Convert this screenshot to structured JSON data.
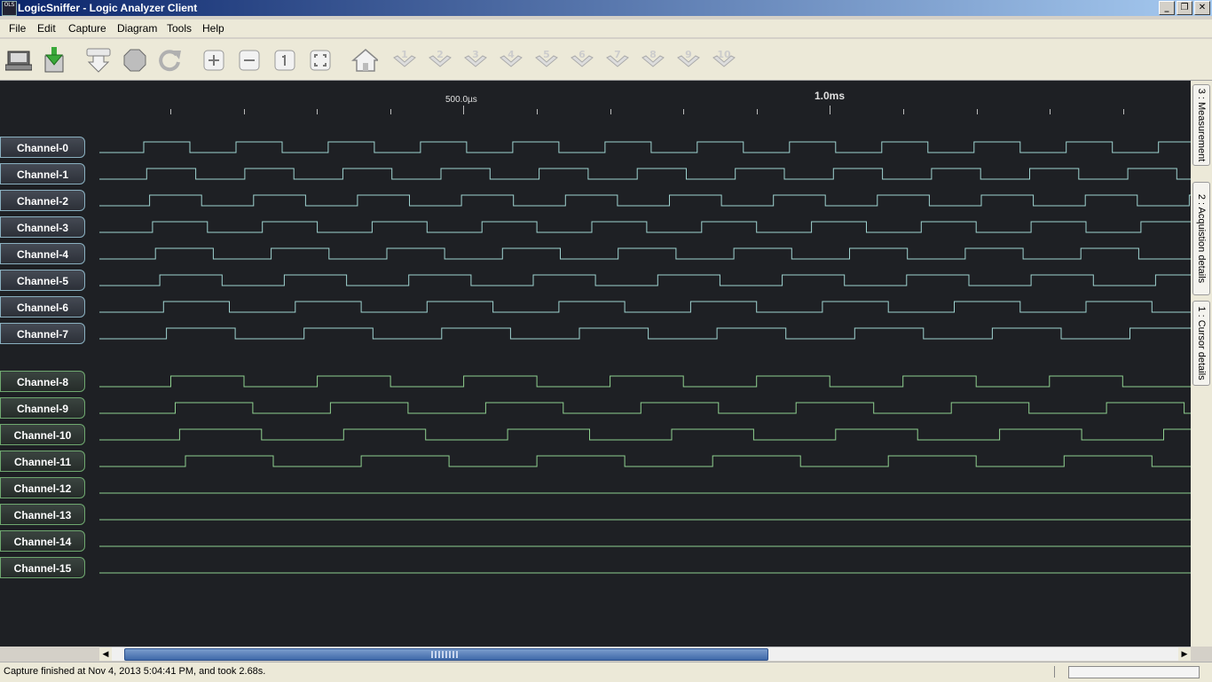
{
  "window": {
    "logo_text": "OLS",
    "title": "LogicSniffer - Logic Analyzer Client",
    "minimize": "_",
    "restore": "❐",
    "close": "✕"
  },
  "menu": [
    {
      "label": "File"
    },
    {
      "label": "Edit"
    },
    {
      "label": "Capture"
    },
    {
      "label": "Diagram"
    },
    {
      "label": "Tools"
    },
    {
      "label": "Help"
    }
  ],
  "toolbar": {
    "cursor_numbers": [
      "1",
      "2",
      "3",
      "4",
      "5",
      "6",
      "7",
      "8",
      "9",
      "10"
    ]
  },
  "ruler": {
    "label_500": "500.0µs",
    "label_1ms": "1.0ms"
  },
  "channels": [
    {
      "name": "Channel-0",
      "color": "#9fd3d0",
      "half_period_us": 63
    },
    {
      "name": "Channel-1",
      "color": "#9fd3d0",
      "half_period_us": 67
    },
    {
      "name": "Channel-2",
      "color": "#9fd3d0",
      "half_period_us": 71
    },
    {
      "name": "Channel-3",
      "color": "#9fd3d0",
      "half_period_us": 75
    },
    {
      "name": "Channel-4",
      "color": "#9fd3d0",
      "half_period_us": 79
    },
    {
      "name": "Channel-5",
      "color": "#9fd3d0",
      "half_period_us": 85
    },
    {
      "name": "Channel-6",
      "color": "#9fd3d0",
      "half_period_us": 90
    },
    {
      "name": "Channel-7",
      "color": "#9fd3d0",
      "half_period_us": 94
    },
    {
      "name": "Channel-8",
      "color": "#8fd08f",
      "half_period_us": 100
    },
    {
      "name": "Channel-9",
      "color": "#8fd08f",
      "half_period_us": 106
    },
    {
      "name": "Channel-10",
      "color": "#8fd08f",
      "half_period_us": 112
    },
    {
      "name": "Channel-11",
      "color": "#8fd08f",
      "half_period_us": 120
    },
    {
      "name": "Channel-12",
      "color": "#8fd08f",
      "half_period_us": 0
    },
    {
      "name": "Channel-13",
      "color": "#8fd08f",
      "half_period_us": 0
    },
    {
      "name": "Channel-14",
      "color": "#8fd08f",
      "half_period_us": 0
    },
    {
      "name": "Channel-15",
      "color": "#8fd08f",
      "half_period_us": 0
    }
  ],
  "side_tabs": [
    {
      "label": "3 : Measurement"
    },
    {
      "label": "2 : Acquistion details"
    },
    {
      "label": "1 : Cursor details"
    }
  ],
  "status": {
    "text": "Capture finished at Nov 4, 2013 5:04:41 PM, and took 2.68s."
  }
}
